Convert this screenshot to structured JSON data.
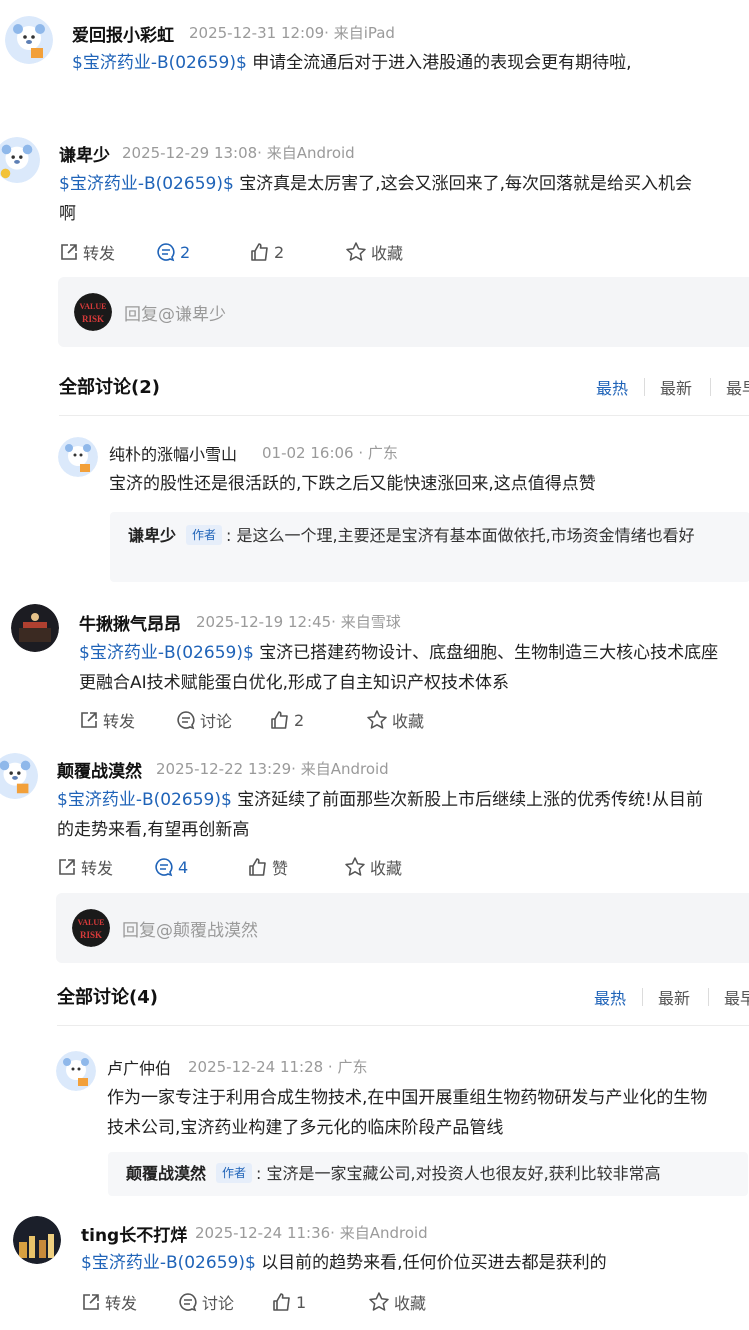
{
  "stock_tag": "$宝济药业-B(02659)$",
  "colors": {
    "link": "#1f63b8",
    "meta": "#9a9a9a",
    "reply_bg": "#f4f5f7"
  },
  "post1": {
    "user": "爱回报小彩虹",
    "meta": "2025-12-31 12:09· 来自iPad",
    "text": "申请全流通后对于进入港股通的表现会更有期待啦,"
  },
  "post2": {
    "user": "谦卑少",
    "meta": "2025-12-29 13:08· 来自Android",
    "text_line1": "宝济真是太厉害了,这会又涨回来了,每次回落就是给买入机会",
    "text_line2": "啊",
    "actions": {
      "share": "转发",
      "comments": "2",
      "likes": "2",
      "fav": "收藏"
    },
    "reply_placeholder": "回复@谦卑少",
    "discussion": {
      "title": "全部讨论(2)",
      "sort_hot": "最热",
      "sort_new": "最新",
      "sort_early": "最早"
    },
    "comment": {
      "user": "纯朴的涨幅小雪山",
      "meta": "01-02 16:06 · 广东",
      "text": "宝济的股性还是很活跃的,下跌之后又能快速涨回来,这点值得点赞",
      "reply_user": "谦卑少",
      "reply_tag": "作者",
      "reply_text": ":  是这么一个理,主要还是宝济有基本面做依托,市场资金情绪也看好"
    }
  },
  "post3": {
    "user": "牛揪揪气昂昂",
    "meta": "2025-12-19 12:45· 来自雪球",
    "text_line1": "宝济已搭建药物设计、底盘细胞、生物制造三大核心技术底座",
    "text_line2": "更融合AI技术赋能蛋白优化,形成了自主知识产权技术体系",
    "actions": {
      "share": "转发",
      "comments": "讨论",
      "likes": "2",
      "fav": "收藏"
    }
  },
  "post4": {
    "user": "颠覆战漠然",
    "meta": "2025-12-22 13:29· 来自Android",
    "text_line1": "宝济延续了前面那些次新股上市后继续上涨的优秀传统!从目前",
    "text_line2": "的走势来看,有望再创新高",
    "actions": {
      "share": "转发",
      "comments": "4",
      "likes": "赞",
      "fav": "收藏"
    },
    "reply_placeholder": "回复@颠覆战漠然",
    "discussion": {
      "title": "全部讨论(4)",
      "sort_hot": "最热",
      "sort_new": "最新",
      "sort_early": "最早"
    },
    "comment": {
      "user": "卢广仲伯",
      "meta": "2025-12-24 11:28 · 广东",
      "text_line1": "作为一家专注于利用合成生物技术,在中国开展重组生物药物研发与产业化的生物",
      "text_line2": "技术公司,宝济药业构建了多元化的临床阶段产品管线",
      "reply_user": "颠覆战漠然",
      "reply_tag": "作者",
      "reply_text": ":  宝济是一家宝藏公司,对投资人也很友好,获利比较非常高"
    }
  },
  "post5": {
    "user": "ting长不打烊",
    "meta": "2025-12-24 11:36· 来自Android",
    "text": "以目前的趋势来看,任何价位买进去都是获利的",
    "actions": {
      "share": "转发",
      "comments": "讨论",
      "likes": "1",
      "fav": "收藏"
    }
  }
}
